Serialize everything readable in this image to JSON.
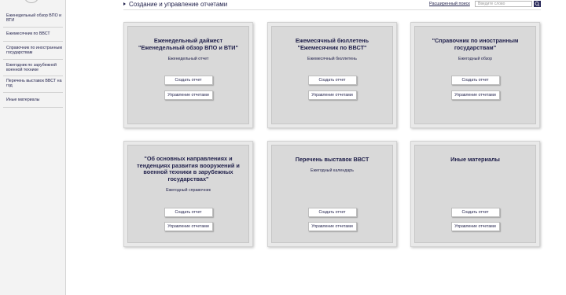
{
  "sidebar": {
    "items": [
      {
        "label": "Еженедельный обзор ВПО и ВТИ"
      },
      {
        "label": "Ежемесячник по ВВСТ"
      },
      {
        "label": "Справочник по иностранным государствам"
      },
      {
        "label": "Ежегодник по зарубежной военной технике"
      },
      {
        "label": "Перечень выставок ВВСТ на год"
      },
      {
        "label": "Иные материалы"
      }
    ]
  },
  "header": {
    "title": "Создание и управление отчетами",
    "advanced_search": "Расширенный поиск",
    "search_placeholder": "Введите слово"
  },
  "cards": [
    {
      "title": "Еженедельный дайжест \"Еженедельный обзор ВПО и ВТИ\"",
      "subtitle": "Еженедельный отчет",
      "create_label": "Создать отчет",
      "manage_label": "Управление отчетами"
    },
    {
      "title": "Ежемесячный бюллетень \"Ежемесячник по ВВСТ\"",
      "subtitle": "Ежемесячный бюллетень",
      "create_label": "Создать отчет",
      "manage_label": "Управление отчетами"
    },
    {
      "title": "\"Справочник по иностранным государствам\"",
      "subtitle": "Ежегодный обзор",
      "create_label": "Создать отчет",
      "manage_label": "Управление отчетами"
    },
    {
      "title": "\"Об основных направлениях и тенденциях развития вооружений и военной техники в зарубежных государствах\"",
      "subtitle": "Ежегодный справочник",
      "create_label": "Создать отчет",
      "manage_label": "Управление отчетами"
    },
    {
      "title": "Перечень выставок ВВСТ",
      "subtitle": "Ежегодный календарь",
      "create_label": "Создать отчет",
      "manage_label": "Управление отчетами"
    },
    {
      "title": "Иные материалы",
      "subtitle": "",
      "create_label": "Создать отчет",
      "manage_label": "Управление отчетами"
    }
  ],
  "icons": {
    "header_arrow": "triangle-right-icon",
    "search_button": "search-icon"
  },
  "colors": {
    "text": "#1f1f4a",
    "card_bg": "#d9d9d9",
    "search_button": "#2a2a5a"
  }
}
